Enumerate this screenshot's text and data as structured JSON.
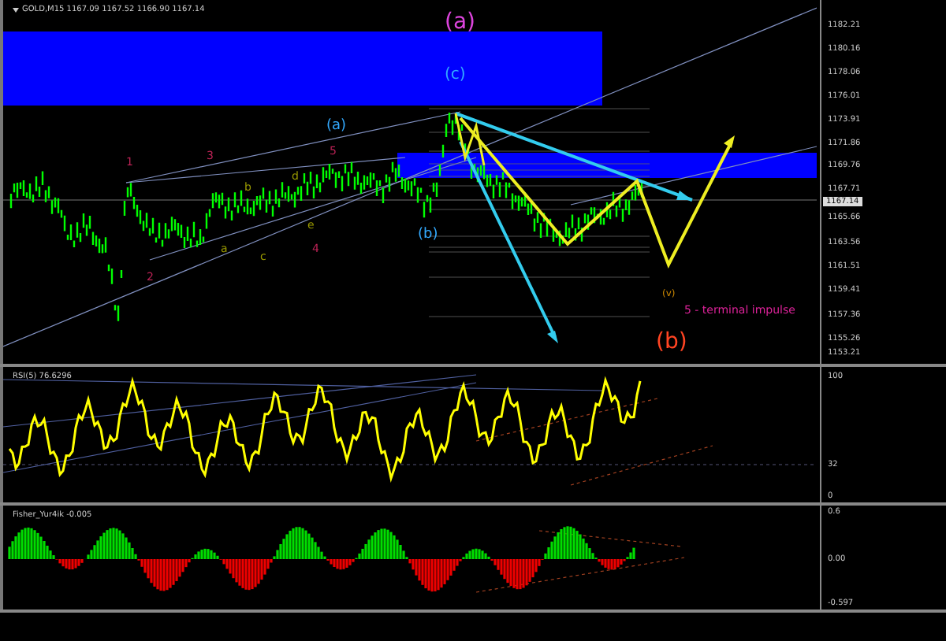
{
  "chart": {
    "header": "GOLD,M15 1167.09 1167.52 1166.90 1167.14",
    "price_axis": [
      "1182.21",
      "1180.16",
      "1178.06",
      "1176.01",
      "1173.91",
      "1171.86",
      "1169.76",
      "1167.71",
      "1165.66",
      "1163.56",
      "1161.51",
      "1159.41",
      "1157.36",
      "1155.26",
      "1153.21"
    ],
    "current_price": "1167.14",
    "wave_labels": [
      {
        "text": "1",
        "color": "#bb2255"
      },
      {
        "text": "2",
        "color": "#bb2255"
      },
      {
        "text": "3",
        "color": "#bb2255"
      },
      {
        "text": "a",
        "color": "#999900"
      },
      {
        "text": "b",
        "color": "#999900"
      },
      {
        "text": "c",
        "color": "#999900"
      },
      {
        "text": "d",
        "color": "#999900"
      },
      {
        "text": "e",
        "color": "#999900"
      },
      {
        "text": "4",
        "color": "#bb2255"
      },
      {
        "text": "5",
        "color": "#bb2255"
      },
      {
        "text": "(a)",
        "color": "#33aaff"
      },
      {
        "text": "(b)",
        "color": "#33aaff"
      },
      {
        "text": "(a)",
        "color": "#dd44dd"
      },
      {
        "text": "(c)",
        "color": "#33aaff"
      },
      {
        "text": "(v)",
        "color": "#cc8800"
      },
      {
        "text": "(b)",
        "color": "#ff4422"
      },
      {
        "text": "5 - terminal impulse",
        "color": "#dd2299"
      }
    ]
  },
  "rsi": {
    "label": "RSI(5) 76.6296",
    "axis": [
      "100",
      "32",
      "0"
    ]
  },
  "fisher": {
    "label": "Fisher_Yur4ik -0.005",
    "axis": [
      "0.6",
      "0.00",
      "-0.597"
    ]
  }
}
